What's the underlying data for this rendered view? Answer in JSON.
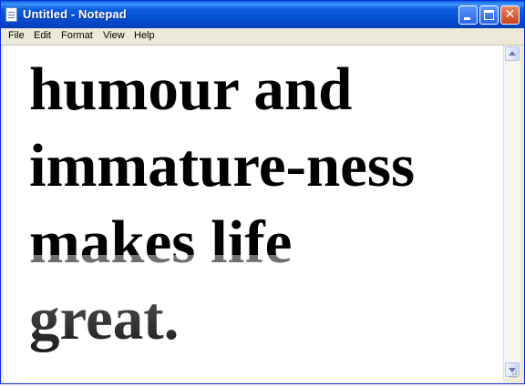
{
  "window": {
    "title": "Untitled - Notepad"
  },
  "titlebar": {
    "icons": [
      "notepad-icon",
      "minimize-icon",
      "maximize-icon",
      "close-icon"
    ],
    "close_glyph": "✕"
  },
  "menu": {
    "file": "File",
    "edit": "Edit",
    "format": "Format",
    "view": "View",
    "help": "Help"
  },
  "editor": {
    "content": "humour and\nimmature-ness\nmakes life\ngreat."
  },
  "colors": {
    "titlebar": "#0a5fe0",
    "close_button": "#c8431c",
    "menubar": "#ece9d8"
  }
}
